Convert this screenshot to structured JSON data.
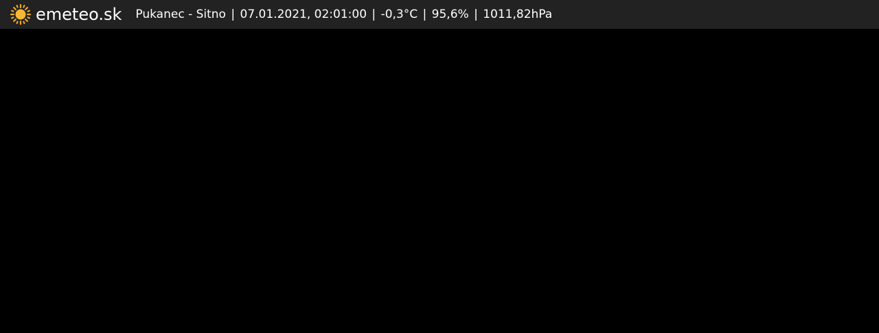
{
  "header": {
    "brand": "emeteo.sk",
    "logo_icon": "sun-icon",
    "accent": "#f5a623",
    "station": "Pukanec - Sitno",
    "datetime": "07.01.2021, 02:01:00",
    "temperature": "-0,3°C",
    "humidity": "95,6%",
    "pressure": "1011,82hPa",
    "separator": "|"
  }
}
